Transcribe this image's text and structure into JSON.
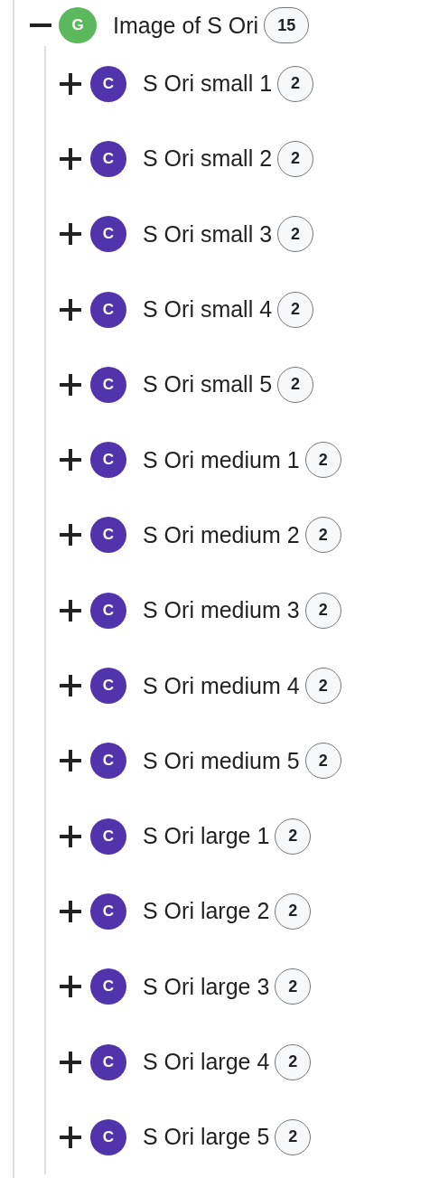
{
  "tree": {
    "label": "Image of S Ori",
    "type_letter": "G",
    "color": "#5cb85c",
    "count": "15",
    "expanded": true,
    "children": [
      {
        "label": "S Ori small 1",
        "type_letter": "C",
        "color": "#5133ab",
        "count": "2",
        "expanded": false
      },
      {
        "label": "S Ori small 2",
        "type_letter": "C",
        "color": "#5133ab",
        "count": "2",
        "expanded": false
      },
      {
        "label": "S Ori small 3",
        "type_letter": "C",
        "color": "#5133ab",
        "count": "2",
        "expanded": false
      },
      {
        "label": "S Ori small 4",
        "type_letter": "C",
        "color": "#5133ab",
        "count": "2",
        "expanded": false
      },
      {
        "label": "S Ori small 5",
        "type_letter": "C",
        "color": "#5133ab",
        "count": "2",
        "expanded": false
      },
      {
        "label": "S Ori medium 1",
        "type_letter": "C",
        "color": "#5133ab",
        "count": "2",
        "expanded": false
      },
      {
        "label": "S Ori medium 2",
        "type_letter": "C",
        "color": "#5133ab",
        "count": "2",
        "expanded": false
      },
      {
        "label": "S Ori medium 3",
        "type_letter": "C",
        "color": "#5133ab",
        "count": "2",
        "expanded": false
      },
      {
        "label": "S Ori medium 4",
        "type_letter": "C",
        "color": "#5133ab",
        "count": "2",
        "expanded": false
      },
      {
        "label": "S Ori medium 5",
        "type_letter": "C",
        "color": "#5133ab",
        "count": "2",
        "expanded": false
      },
      {
        "label": "S Ori large 1",
        "type_letter": "C",
        "color": "#5133ab",
        "count": "2",
        "expanded": false
      },
      {
        "label": "S Ori large 2",
        "type_letter": "C",
        "color": "#5133ab",
        "count": "2",
        "expanded": false
      },
      {
        "label": "S Ori large 3",
        "type_letter": "C",
        "color": "#5133ab",
        "count": "2",
        "expanded": false
      },
      {
        "label": "S Ori large 4",
        "type_letter": "C",
        "color": "#5133ab",
        "count": "2",
        "expanded": false
      },
      {
        "label": "S Ori large 5",
        "type_letter": "C",
        "color": "#5133ab",
        "count": "2",
        "expanded": false
      }
    ]
  }
}
